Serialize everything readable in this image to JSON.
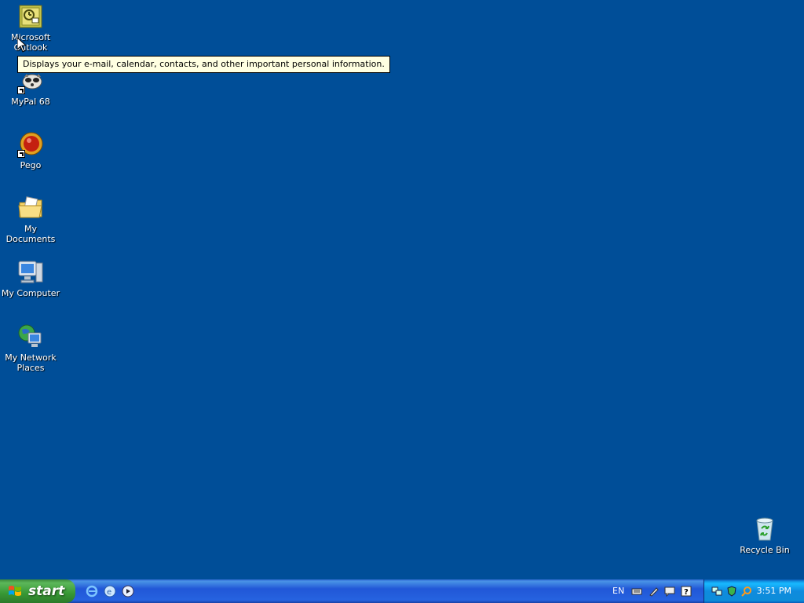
{
  "desktop": {
    "icons": [
      {
        "label": "Microsoft Outlook"
      },
      {
        "label": "MyPal 68"
      },
      {
        "label": "Pego"
      },
      {
        "label": "My Documents"
      },
      {
        "label": "My Computer"
      },
      {
        "label": "My Network Places"
      },
      {
        "label": "Recycle Bin"
      }
    ],
    "tooltip": "Displays your e-mail, calendar, contacts, and other important personal information."
  },
  "taskbar": {
    "start_label": "start",
    "language": "EN",
    "clock": "3:51 PM"
  },
  "colors": {
    "desktop_background": "#004E98",
    "taskbar_blue": "#2157D7",
    "start_green": "#379834",
    "tooltip_background": "#FFFFE1"
  }
}
